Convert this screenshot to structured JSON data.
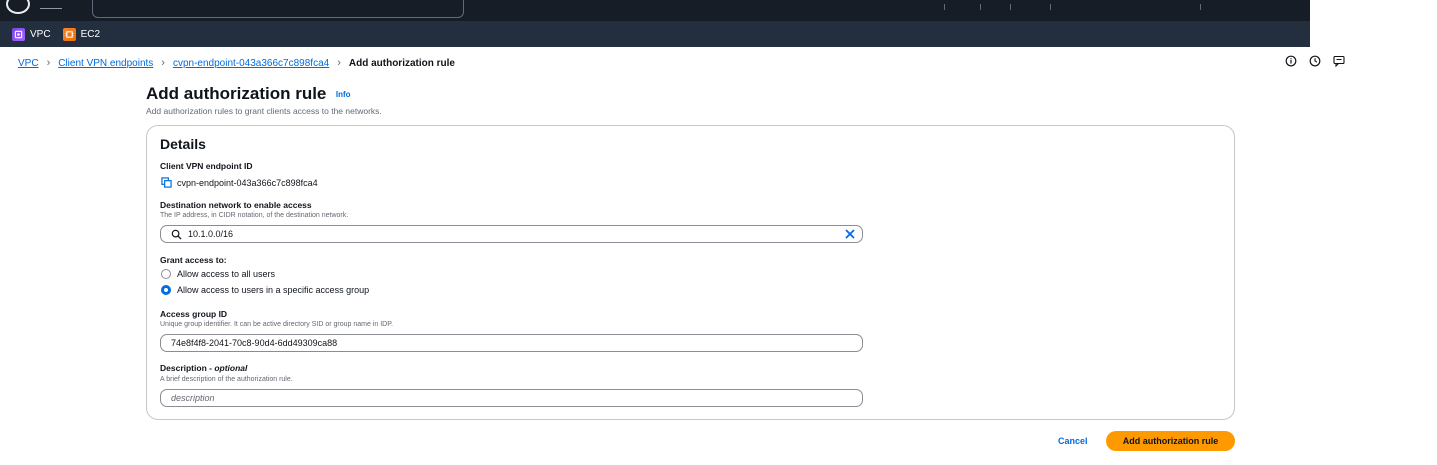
{
  "services": [
    {
      "label": "VPC",
      "icon": "vpc-service-icon",
      "color": "#8c4fff"
    },
    {
      "label": "EC2",
      "icon": "ec2-service-icon",
      "color": "#ed7100"
    }
  ],
  "breadcrumb": {
    "items": [
      "VPC",
      "Client VPN endpoints",
      "cvpn-endpoint-043a366c7c898fca4"
    ],
    "current": "Add authorization rule"
  },
  "utility_icons": [
    "info-icon",
    "clock-icon",
    "feedback-icon"
  ],
  "page": {
    "title": "Add authorization rule",
    "info_link": "Info",
    "description": "Add authorization rules to grant clients access to the networks."
  },
  "details": {
    "title": "Details",
    "endpoint_label": "Client VPN endpoint ID",
    "endpoint_value": "cvpn-endpoint-043a366c7c898fca4",
    "destination_label": "Destination network to enable access",
    "destination_hint": "The IP address, in CIDR notation, of the destination network.",
    "destination_value": "10.1.0.0/16",
    "grant_label": "Grant access to:",
    "grant_options": [
      {
        "label": "Allow access to all users",
        "selected": false
      },
      {
        "label": "Allow access to users in a specific access group",
        "selected": true
      }
    ],
    "group_label": "Access group ID",
    "group_hint": "Unique group identifier. It can be active directory SID or group name in IDP.",
    "group_value": "74e8f4f8-2041-70c8-90d4-6dd49309ca88",
    "description_label": "Description",
    "description_optional": "optional",
    "description_hint": "A brief description of the authorization rule.",
    "description_placeholder": "description"
  },
  "actions": {
    "cancel": "Cancel",
    "submit": "Add authorization rule"
  },
  "colors": {
    "primary": "#ff9900",
    "link": "#006ce0",
    "header": "#161d26",
    "service_bar": "#232f3e"
  }
}
